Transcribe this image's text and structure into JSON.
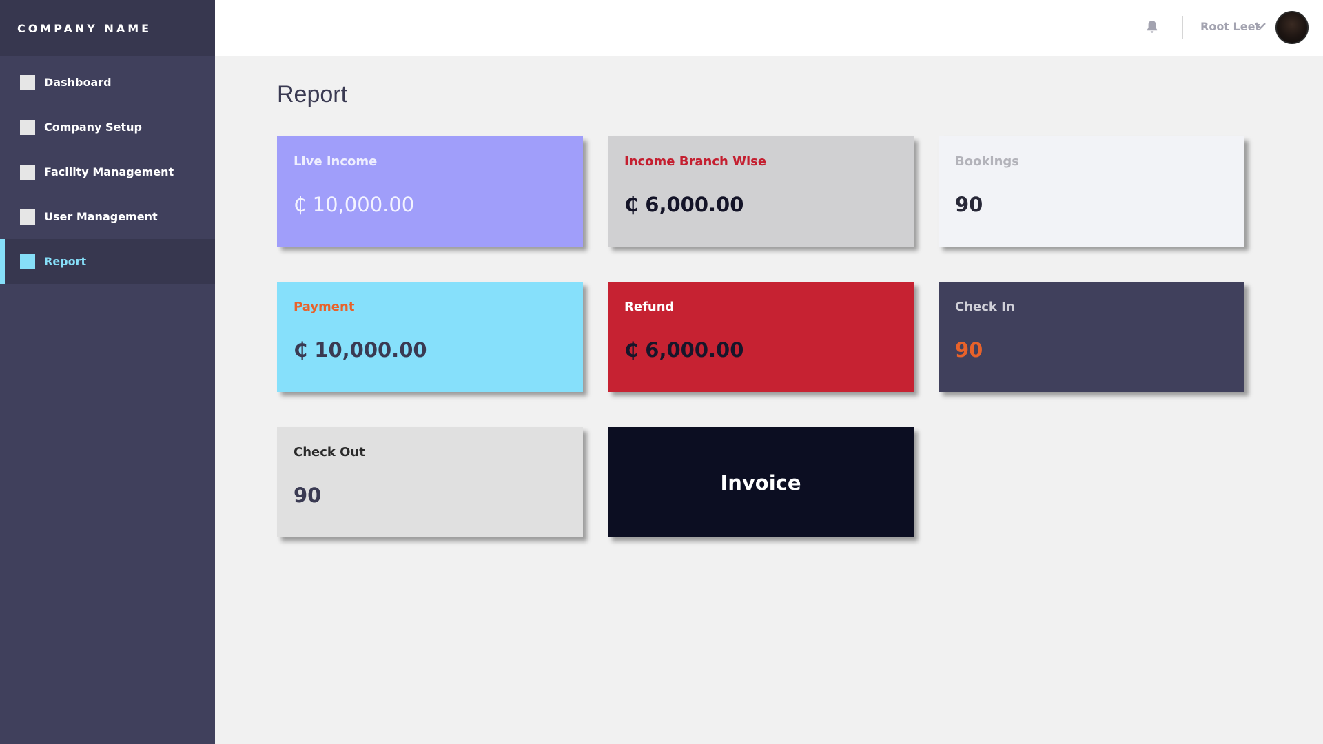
{
  "app": {
    "brand": "COMPANY NAME"
  },
  "sidebar": {
    "items": [
      {
        "label": "Dashboard"
      },
      {
        "label": "Company Setup"
      },
      {
        "label": "Facility Management"
      },
      {
        "label": "User Management"
      },
      {
        "label": "Report",
        "active": true
      }
    ]
  },
  "header": {
    "user_name": "Root Leet",
    "icons": [
      "bell-icon",
      "chevron-down-icon",
      "avatar"
    ]
  },
  "page": {
    "title": "Report"
  },
  "cards": [
    {
      "label": "Live Income",
      "value": "₵ 10,000.00",
      "bg": "#a09efa",
      "label_color": "#eeeefe",
      "value_color": "#f3f3ff"
    },
    {
      "label": "Income Branch Wise",
      "value": "₵ 6,000.00",
      "bg": "#d0d0d2",
      "label_color": "#c41f30",
      "value_color": "#141428"
    },
    {
      "label": "Bookings",
      "value": "90",
      "bg": "#f2f3f7",
      "label_color": "#b3b3ba",
      "value_color": "#282838"
    },
    {
      "label": "Payment",
      "value": "₵ 10,000.00",
      "bg": "#86e0fb",
      "label_color": "#e8622a",
      "value_color": "#3a3a52"
    },
    {
      "label": "Refund",
      "value": "₵ 6,000.00",
      "bg": "#c62232",
      "label_color": "#ffffff",
      "value_color": "#16162a"
    },
    {
      "label": "Check In",
      "value": "90",
      "bg": "#40405c",
      "label_color": "#d0d0d8",
      "value_color": "#e8622a"
    },
    {
      "label": "Check Out",
      "value": "90",
      "bg": "#e0e0e0",
      "label_color": "#2a2a2a",
      "value_color": "#3a3a52"
    }
  ],
  "invoice": {
    "label": "Invoice",
    "bg": "#0c0e22"
  }
}
